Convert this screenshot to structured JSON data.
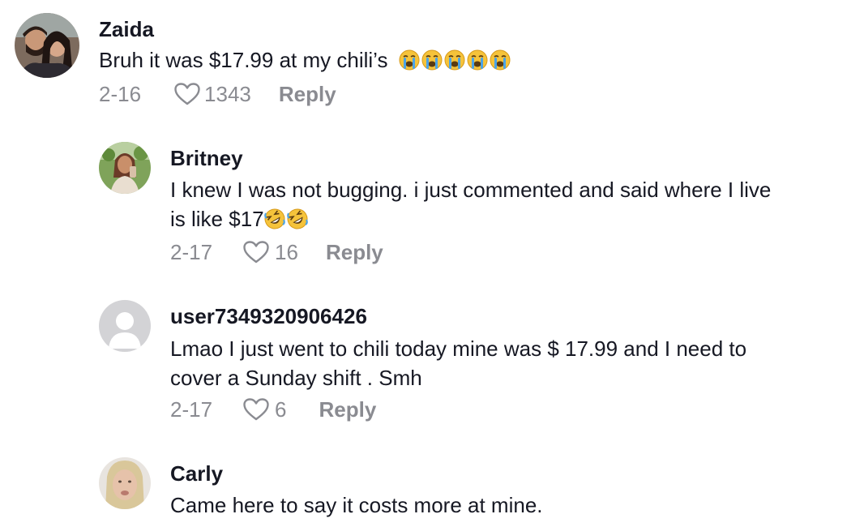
{
  "comments": [
    {
      "username": "Zaida",
      "text": "Bruh it was $17.99 at my chili’s",
      "emoji": "loudly-crying-face",
      "emoji_count": 5,
      "date": "2-16",
      "likes": "1343",
      "reply_label": "Reply"
    },
    {
      "username": "Britney",
      "text_line1": "I knew I was not bugging. i just commented and said where I live",
      "text_line2": "is like $17",
      "emoji": "rolling-on-floor-laughing-face",
      "emoji_count": 2,
      "date": "2-17",
      "likes": "16",
      "reply_label": "Reply"
    },
    {
      "username": "user7349320906426",
      "text_line1": "Lmao I just went to chili today mine was $ 17.99 and I need to",
      "text_line2": "cover a Sunday shift . Smh",
      "avatar": "default-avatar-icon",
      "date": "2-17",
      "likes": "6",
      "reply_label": "Reply"
    },
    {
      "username": "Carly",
      "text": "Came here to say it costs more at mine."
    }
  ],
  "colors": {
    "text": "#161823",
    "meta": "#8a8b91",
    "emoji": "#f5c33b",
    "tears": "#4aa3e8"
  }
}
